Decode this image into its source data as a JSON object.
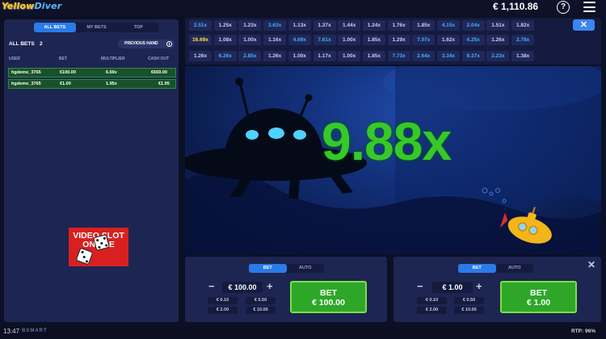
{
  "header": {
    "logo_part1": "Yellow",
    "logo_part2": "Diver",
    "balance": "€ 1,110.86",
    "help_label": "?"
  },
  "left_panel": {
    "tabs": [
      "ALL BETS",
      "MY BETS",
      "TOP"
    ],
    "active_tab": "ALL BETS",
    "all_bets_label": "ALL BETS",
    "all_bets_count": "2",
    "previous_hand_label": "PREVIOUS HAND",
    "columns": [
      "USER",
      "BET",
      "MULTIPLIER",
      "CASH OUT"
    ],
    "rows": [
      {
        "user": "hgdemo_3765",
        "bet": "€100.00",
        "multiplier": "6.69x",
        "cash_out": "€669.00"
      },
      {
        "user": "hgdemo_3765",
        "bet": "€1.00",
        "multiplier": "1.95x",
        "cash_out": "€1.95"
      }
    ],
    "promo_line1": "VIDEO SLOT",
    "promo_line2": "ONLINE"
  },
  "history": {
    "row1": [
      "2.51x",
      "1.25x",
      "1.23x",
      "3.63x",
      "1.13x",
      "1.37x",
      "1.44x",
      "1.24x",
      "1.76x",
      "1.85x",
      "4.15x",
      "2.04x",
      "1.51x",
      "1.82x"
    ],
    "row2": [
      "16.69x",
      "1.08x",
      "1.00x",
      "1.16x",
      "4.69x",
      "7.61x",
      "1.00x",
      "1.85x",
      "1.29x",
      "7.07x",
      "1.62x",
      "4.25x",
      "1.26x",
      "2.78x"
    ],
    "row3": [
      "1.26x",
      "6.26x",
      "2.85x",
      "1.26x",
      "1.00x",
      "1.17x",
      "1.00x",
      "1.85x",
      "7.73x",
      "2.64x",
      "3.34x",
      "9.37x",
      "2.23x",
      "1.38x"
    ],
    "row1_colors": [
      "blue",
      "",
      "",
      "blue",
      "",
      "",
      "",
      "",
      "",
      "",
      "blue",
      "blue",
      "",
      ""
    ],
    "row2_colors": [
      "yellow",
      "",
      "",
      "",
      "blue",
      "blue",
      "",
      "",
      "",
      "blue",
      "",
      "blue",
      "",
      "blue"
    ],
    "row3_colors": [
      "",
      "blue",
      "blue",
      "",
      "",
      "",
      "",
      "",
      "blue",
      "blue",
      "blue",
      "blue",
      "blue",
      ""
    ],
    "close_label": "✕"
  },
  "game": {
    "multiplier": "9.88x"
  },
  "bet_panel_1": {
    "tabs": [
      "BET",
      "AUTO"
    ],
    "active_tab": "BET",
    "amount": "€ 100.00",
    "minus": "−",
    "plus": "+",
    "chips": [
      "€ 0.10",
      "€ 0.50",
      "€ 2.00",
      "€ 10.00"
    ],
    "button_line1": "BET",
    "button_line2": "€ 100.00"
  },
  "bet_panel_2": {
    "tabs": [
      "BET",
      "AUTO"
    ],
    "active_tab": "BET",
    "amount": "€ 1.00",
    "minus": "−",
    "plus": "+",
    "chips": [
      "€ 0.10",
      "€ 0.50",
      "€ 2.00",
      "€ 10.00"
    ],
    "button_line1": "BET",
    "button_line2": "€ 1.00",
    "close_label": "✕"
  },
  "footer": {
    "time": "13:47",
    "brand": "BSMART",
    "rtp": "RTP: 96%"
  },
  "colors": {
    "accent_blue": "#2a7bea",
    "bet_green": "#2ea729",
    "multiplier_green": "#36c928",
    "history_blue": "#3fb0ff",
    "history_yellow": "#ffe23a",
    "promo_red": "#d82020"
  }
}
